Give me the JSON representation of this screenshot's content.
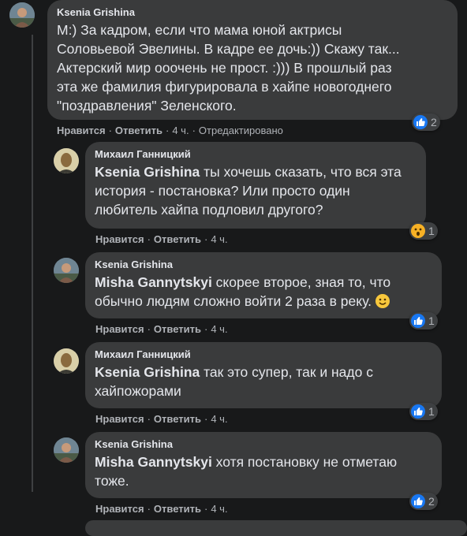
{
  "comments": [
    {
      "author": "Ksenia Grishina",
      "mention": "",
      "text": "М:) За кадром, если что мама юной актрисы\nСоловьевой Эвелины. В кадре ее дочь:)) Скажу так...\nАктерский мир ооочень не прост. :))) В прошлый раз\nэта же фамилия фигурировала в хайпе новогоднего\n\"поздравления\" Зеленского.",
      "like_label": "Нравится",
      "reply_label": "Ответить",
      "time": "4 ч.",
      "edited": "Отредактировано",
      "reaction_icon": "like-icon",
      "reaction_count": "2"
    },
    {
      "author": "Михаил Ганницкий",
      "mention": "Ksenia Grishina",
      "text": " ты хочешь сказать, что вся эта\nистория - постановка? Или просто один\nлюбитель хайпа подловил другого?",
      "like_label": "Нравится",
      "reply_label": "Ответить",
      "time": "4 ч.",
      "reaction_icon": "wow-icon",
      "reaction_count": "1"
    },
    {
      "author": "Ksenia Grishina",
      "mention": "Misha Gannytskyi",
      "text": " скорее второе, зная то, что\nобычно людям сложно войти 2 раза в реку. ",
      "like_label": "Нравится",
      "reply_label": "Ответить",
      "time": "4 ч.",
      "reaction_icon": "like-icon",
      "reaction_count": "1"
    },
    {
      "author": "Михаил Ганницкий",
      "mention": "Ksenia Grishina",
      "text": " так это супер, так и надо с\nхайпожорами",
      "like_label": "Нравится",
      "reply_label": "Ответить",
      "time": "4 ч.",
      "reaction_icon": "like-icon",
      "reaction_count": "1"
    },
    {
      "author": "Ksenia Grishina",
      "mention": "Misha Gannytskyi",
      "text": " хотя постановку не отметаю\nтоже.",
      "like_label": "Нравится",
      "reply_label": "Ответить",
      "time": "4 ч.",
      "reaction_icon": "like-icon",
      "reaction_count": "2"
    }
  ],
  "colors": {
    "background": "#18191a",
    "bubble": "#3a3b3c",
    "text": "#e4e6eb",
    "secondary": "#b0b3b8",
    "like": "#1877f2",
    "wow": "#f7b125"
  }
}
